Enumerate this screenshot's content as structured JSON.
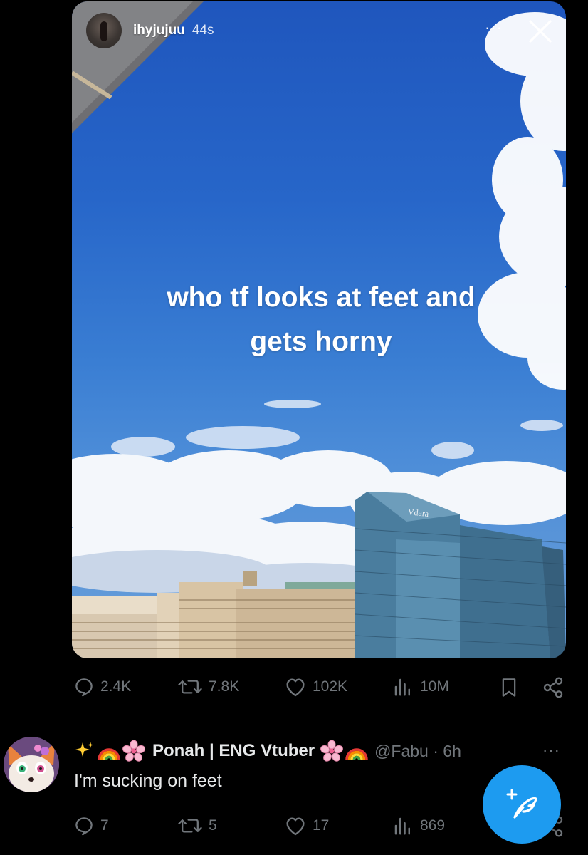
{
  "story": {
    "username": "ihyjujuu",
    "time": "44s",
    "more_label": "···",
    "caption_line1": "who tf looks at feet and",
    "caption_line2": "gets horny",
    "building_sign": "Vdara"
  },
  "tweet_actions": {
    "replies": "2.4K",
    "reposts": "7.8K",
    "likes": "102K",
    "views": "10M"
  },
  "reply": {
    "display_name": "Ponah | ENG Vtuber",
    "handle_time": "@Fabu · 6h",
    "more_label": "···",
    "text": "I'm sucking on feet",
    "actions": {
      "replies": "7",
      "reposts": "5",
      "likes": "17",
      "views": "869"
    }
  },
  "icons": {
    "reply": "speech-bubble-icon",
    "repost": "repost-arrows-icon",
    "like": "heart-icon",
    "views": "bar-chart-icon",
    "bookmark": "bookmark-icon",
    "share": "share-icon",
    "compose": "feather-plus-icon",
    "close": "close-icon"
  },
  "colors": {
    "accent": "#1d9bf0",
    "muted": "#71767b",
    "text": "#e7e9ea",
    "background": "#000000",
    "sky": "#2766c9"
  }
}
